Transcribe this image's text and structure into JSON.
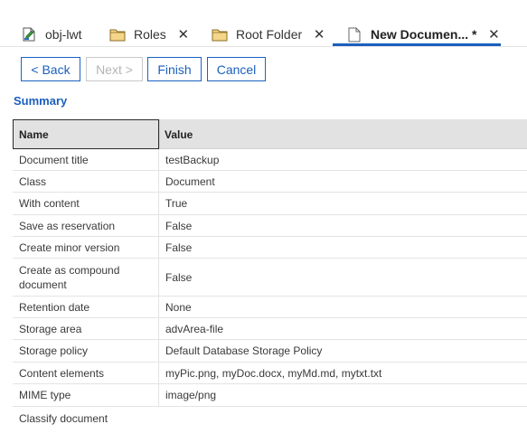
{
  "tabs": [
    {
      "label": "obj-lwt",
      "icon": "document-edit-icon",
      "closable": false,
      "active": false
    },
    {
      "label": "Roles",
      "icon": "folder-icon",
      "closable": true,
      "active": false
    },
    {
      "label": "Root Folder",
      "icon": "folder-icon",
      "closable": true,
      "active": false
    },
    {
      "label": "New Documen... *",
      "icon": "document-icon",
      "closable": true,
      "active": true
    }
  ],
  "close_glyph": "✕",
  "buttons": {
    "back": "< Back",
    "next": "Next >",
    "finish": "Finish",
    "cancel": "Cancel"
  },
  "summary": {
    "heading": "Summary",
    "columns": {
      "name": "Name",
      "value": "Value"
    },
    "rows": [
      {
        "name": "Document title",
        "value": "testBackup"
      },
      {
        "name": "Class",
        "value": "Document"
      },
      {
        "name": "With content",
        "value": "True"
      },
      {
        "name": "Save as reservation",
        "value": "False"
      },
      {
        "name": "Create minor version",
        "value": "False"
      },
      {
        "name": "Create as compound document",
        "value": "False"
      },
      {
        "name": "Retention date",
        "value": "None"
      },
      {
        "name": "Storage area",
        "value": "advArea-file"
      },
      {
        "name": "Storage policy",
        "value": "Default Database Storage Policy"
      },
      {
        "name": "Content elements",
        "value": "myPic.png, myDoc.docx, myMd.md, mytxt.txt"
      },
      {
        "name": "MIME type",
        "value": "image/png"
      },
      {
        "name": "Classify document",
        "value": ""
      }
    ]
  },
  "colors": {
    "accent": "#1b5fbd",
    "header_bg": "#e2e2e2",
    "disabled": "#b4b4b4"
  }
}
